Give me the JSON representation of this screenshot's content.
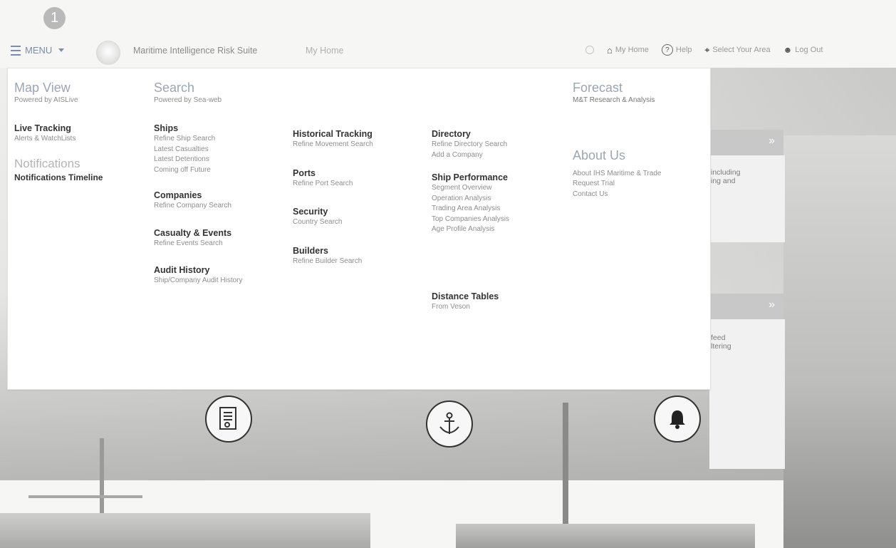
{
  "step_badge": "1",
  "menu_toggle": {
    "label": "MENU"
  },
  "header": {
    "app_title": "Maritime Intelligence Risk Suite",
    "breadcrumb": "My Home",
    "right_nav": [
      {
        "label": "My Home",
        "icon": "home-icon"
      },
      {
        "label": "Help",
        "icon": "help-icon"
      },
      {
        "label": "Select Your Area",
        "icon": "location-icon"
      },
      {
        "label": "Log Out",
        "icon": "user-icon"
      }
    ]
  },
  "menu": {
    "map_view": {
      "title": "Map View",
      "subtitle": "Powered by AISLive",
      "groups": [
        {
          "title": "Live Tracking",
          "links": [
            "Alerts & WatchLists"
          ]
        }
      ],
      "notifications": {
        "title": "Notifications",
        "link": "Notifications Timeline"
      }
    },
    "search": {
      "title": "Search",
      "subtitle": "Powered by Sea-web",
      "col1": [
        {
          "title": "Ships",
          "links": [
            "Refine Ship Search",
            "Latest Casualties",
            "Latest Detentions",
            "Coming off Future"
          ]
        },
        {
          "title": "Companies",
          "links": [
            "Refine Company Search"
          ]
        },
        {
          "title": "Casualty & Events",
          "links": [
            "Refine Events Search"
          ]
        },
        {
          "title": "Audit History",
          "links": [
            "Ship/Company Audit History"
          ]
        }
      ],
      "col2": [
        {
          "title": "Historical Tracking",
          "links": [
            "Refine Movement Search"
          ]
        },
        {
          "title": "Ports",
          "links": [
            "Refine Port Search"
          ]
        },
        {
          "title": "Security",
          "links": [
            "Country Search"
          ]
        },
        {
          "title": "Builders",
          "links": [
            "Refine Builder Search"
          ]
        }
      ],
      "col3": [
        {
          "title": "Directory",
          "links": [
            "Refine Directory Search",
            "Add a Company"
          ]
        },
        {
          "title": "Ship Performance",
          "links": [
            "Segment Overview",
            "Operation Analysis",
            "Trading Area Analysis",
            "Top Companies Analysis",
            "Age Profile Analysis"
          ]
        },
        {
          "title": "Distance Tables",
          "links": [
            "From Veson"
          ]
        }
      ]
    },
    "forecast": {
      "title": "Forecast",
      "subtitle": "M&T Research & Analysis",
      "about": {
        "title": "About Us",
        "links": [
          "About IHS Maritime & Trade",
          "Request Trial",
          "Contact Us"
        ]
      }
    }
  },
  "peek_cards": [
    {
      "text_lines": [
        "including",
        "ing and"
      ]
    },
    {
      "text_lines": [
        "feed",
        "ltering"
      ]
    }
  ]
}
